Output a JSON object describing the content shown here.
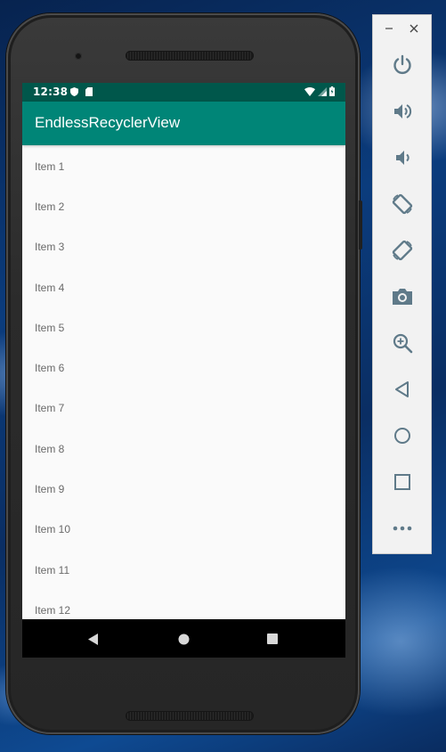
{
  "status_bar": {
    "time": "12:38",
    "left_icons": [
      "shield-icon",
      "sd-card-icon"
    ],
    "right_icons": [
      "wifi-icon",
      "signal-icon",
      "battery-icon"
    ]
  },
  "app_bar": {
    "title": "EndlessRecyclerView"
  },
  "list": {
    "items": [
      "Item 1",
      "Item 2",
      "Item 3",
      "Item 4",
      "Item 5",
      "Item 6",
      "Item 7",
      "Item 8",
      "Item 9",
      "Item 10",
      "Item 11",
      "Item 12"
    ]
  },
  "nav_bar": {
    "buttons": [
      "back-icon",
      "home-icon",
      "recents-icon"
    ]
  },
  "emulator_panel": {
    "window_buttons": [
      "minimize-icon",
      "close-icon"
    ],
    "tools": [
      "power-icon",
      "volume-up-icon",
      "volume-down-icon",
      "rotate-left-icon",
      "rotate-right-icon",
      "camera-icon",
      "zoom-icon",
      "back-icon",
      "home-icon",
      "overview-icon",
      "more-icon"
    ]
  },
  "colors": {
    "status_bar": "#00574b",
    "app_bar": "#008577",
    "list_background": "#fafafa",
    "emulator_icon": "#5f7a89"
  }
}
